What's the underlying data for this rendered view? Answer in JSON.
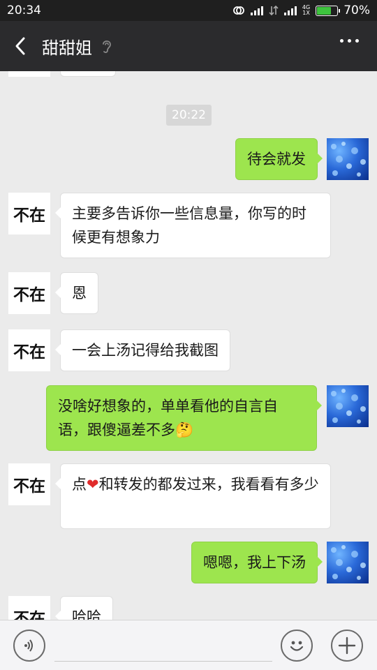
{
  "status_bar": {
    "time": "20:34",
    "battery": "70%",
    "battery_level": 0.7,
    "net_label": "4G",
    "net_sub": "1X"
  },
  "header": {
    "title": "甜甜姐"
  },
  "chat": {
    "timestamp": "20:22",
    "contact_avatar_text": "不在",
    "messages": [
      {
        "side": "out",
        "text": "待会就发"
      },
      {
        "side": "in",
        "text": "主要多告诉你一些信息量，你写的时候更有想象力"
      },
      {
        "side": "in",
        "text": "恩"
      },
      {
        "side": "in",
        "text": "一会上汤记得给我截图"
      },
      {
        "side": "out",
        "text": "没啥好想象的，单单看他的自言自语，跟傻逼差不多",
        "emoji": "🤔"
      },
      {
        "side": "in",
        "text_before": "点",
        "heart": "❤",
        "text_after": "和转发的都发过来，我看看有多少"
      },
      {
        "side": "out",
        "text": "嗯嗯，我上下汤"
      },
      {
        "side": "in",
        "text": "哈哈"
      }
    ]
  },
  "colors": {
    "outgoing_bubble": "#9de54e",
    "incoming_bubble": "#ffffff",
    "nav": "#2b2b2d",
    "background": "#ebebeb"
  }
}
